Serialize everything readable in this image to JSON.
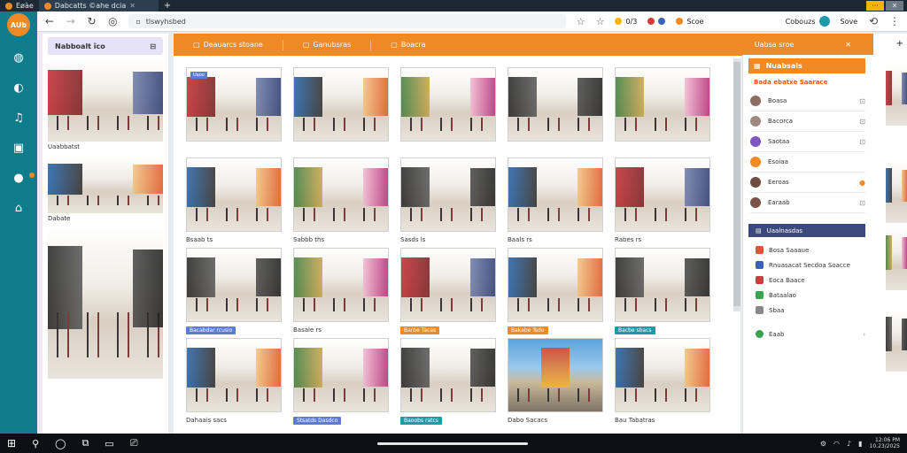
{
  "colors": {
    "accent": "#f08a24",
    "sidebar": "#0f7c8c",
    "navy": "#3a4a7a"
  },
  "tabbar": {
    "tabs": [
      {
        "label": "Eøàe"
      },
      {
        "label": "Dabcatts ©ahe dcia"
      }
    ],
    "new_tab": "+",
    "win_controls": [
      "···",
      "✕"
    ]
  },
  "sidebar": {
    "logo": "AUb",
    "items": [
      "globe-icon",
      "messages-icon",
      "music-icon",
      "board-icon",
      "chat-icon",
      "home-icon"
    ]
  },
  "addressbar": {
    "url": "tlswyhsbed",
    "ext1_label": "0/3",
    "ext2_label": "Scoe",
    "profile_label": "Cobouzs",
    "profile_action": "Sove"
  },
  "leftpane": {
    "header": "Nabboalt ȉco",
    "captions": [
      "Uaabbatst",
      "Dabate"
    ]
  },
  "main": {
    "tabs": [
      "Deauarcs stoane",
      "Ganubsras",
      "Boacra"
    ],
    "right_label": "Uabsa sroe",
    "close": "✕",
    "grid": [
      {
        "label": "",
        "tag": "Uaoo",
        "chip_color": ""
      },
      {
        "label": "",
        "tag": "",
        "chip_color": ""
      },
      {
        "label": "",
        "tag": "",
        "chip_color": ""
      },
      {
        "label": "",
        "tag": "",
        "chip_color": ""
      },
      {
        "label": "",
        "tag": "",
        "chip_color": ""
      },
      {
        "label": "Bsaab ts",
        "tag": "",
        "chip_color": ""
      },
      {
        "label": "Sabbb ths",
        "tag": "",
        "chip_color": ""
      },
      {
        "label": "Sasds ls",
        "tag": "",
        "chip_color": ""
      },
      {
        "label": "Baals rs",
        "tag": "",
        "chip_color": ""
      },
      {
        "label": "Rabes rs",
        "tag": "",
        "chip_color": ""
      },
      {
        "label": "Bacabdar rcusio",
        "tag": "",
        "chip_color": "#5b7bd5"
      },
      {
        "label": "Basale rs",
        "tag": "",
        "chip_color": ""
      },
      {
        "label": "Barbe Tacas",
        "tag": "",
        "chip_color": "#f08a24"
      },
      {
        "label": "Bakabe Tsde",
        "tag": "",
        "chip_color": "#f08a24"
      },
      {
        "label": "Bacbe sbacs",
        "tag": "",
        "chip_color": "#1f9aa8"
      },
      {
        "label": "Dahaais sacs",
        "tag": "",
        "chip_color": ""
      },
      {
        "label": "Stsatds Dasdco",
        "tag": "",
        "chip_color": "#5b7bd5"
      },
      {
        "label": "Baoobs ratcs",
        "tag": "",
        "chip_color": "#1f9aa8"
      },
      {
        "label": "Dabo Sacacs",
        "tag": "",
        "chip_color": ""
      },
      {
        "label": "Bau Tabatras",
        "tag": "",
        "chip_color": ""
      }
    ]
  },
  "right": {
    "header": "Nuabsals",
    "subheader": "Bada ebatxe Saarace",
    "items": [
      {
        "label": "Boasa",
        "tail": "⊡"
      },
      {
        "label": "Bacorca",
        "tail": "⊡"
      },
      {
        "label": "Saotaa",
        "tail": "⊡"
      },
      {
        "label": "Esoiaa",
        "tail": ""
      },
      {
        "label": "Eeroas",
        "tail": "●"
      },
      {
        "label": "Earaab",
        "tail": "⊡"
      }
    ],
    "header2": "Uaalnasdas",
    "items2": [
      {
        "label": "Bosa Saaaue",
        "color": "#e0533a"
      },
      {
        "label": "Rnuasacat Secdoa Soacce",
        "color": "#3a62b5"
      },
      {
        "label": "Eoca Baace",
        "color": "#d13c3c"
      },
      {
        "label": "Bataalao",
        "color": "#3aa34f"
      },
      {
        "label": "Sbaa",
        "color": "#888888"
      }
    ],
    "footer": "Eaab"
  },
  "taskbar": {
    "clock_time": "12:06 PM",
    "clock_date": "10.23/2025"
  }
}
